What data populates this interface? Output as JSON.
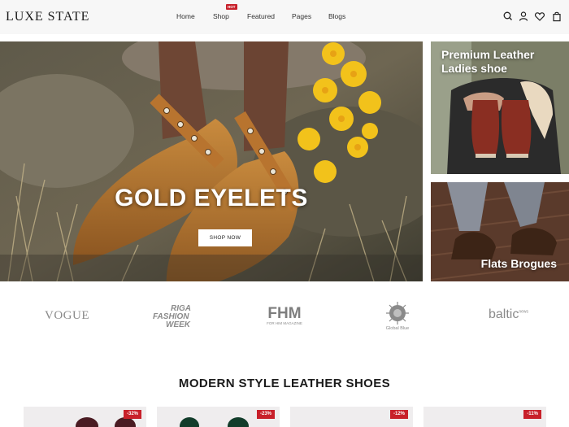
{
  "header": {
    "logo": "LUXE STATE",
    "nav": [
      {
        "label": "Home"
      },
      {
        "label": "Shop",
        "badge": "HOT"
      },
      {
        "label": "Featured"
      },
      {
        "label": "Pages"
      },
      {
        "label": "Blogs"
      }
    ],
    "icons": [
      "search-icon",
      "user-icon",
      "heart-icon",
      "bag-icon"
    ]
  },
  "hero": {
    "title": "GOLD EYELETS",
    "button_label": "SHOP NOW",
    "slides": 2,
    "active_slide": 1
  },
  "side_banners": [
    {
      "line1": "Premium Leather",
      "line2": "Ladies shoe"
    },
    {
      "title": "Flats Brogues"
    }
  ],
  "brands": {
    "vogue": "VOGUE",
    "riga_line1": "RIGA",
    "riga_line2": "FASHION",
    "riga_line3": "WEEK",
    "fhm": "FHM",
    "fhm_sub": "FOR HIM MAGAZINE",
    "global_blue": "Global Blue",
    "baltic": "baltic",
    "baltic_sub": "news"
  },
  "section": {
    "title": "MODERN STYLE LEATHER SHOES"
  },
  "products": [
    {
      "discount": "-32%"
    },
    {
      "discount": "-23%"
    },
    {
      "discount": "-12%"
    },
    {
      "discount": "-11%"
    }
  ],
  "colors": {
    "accent": "#c8202a",
    "header_bg": "#f7f7f7"
  }
}
